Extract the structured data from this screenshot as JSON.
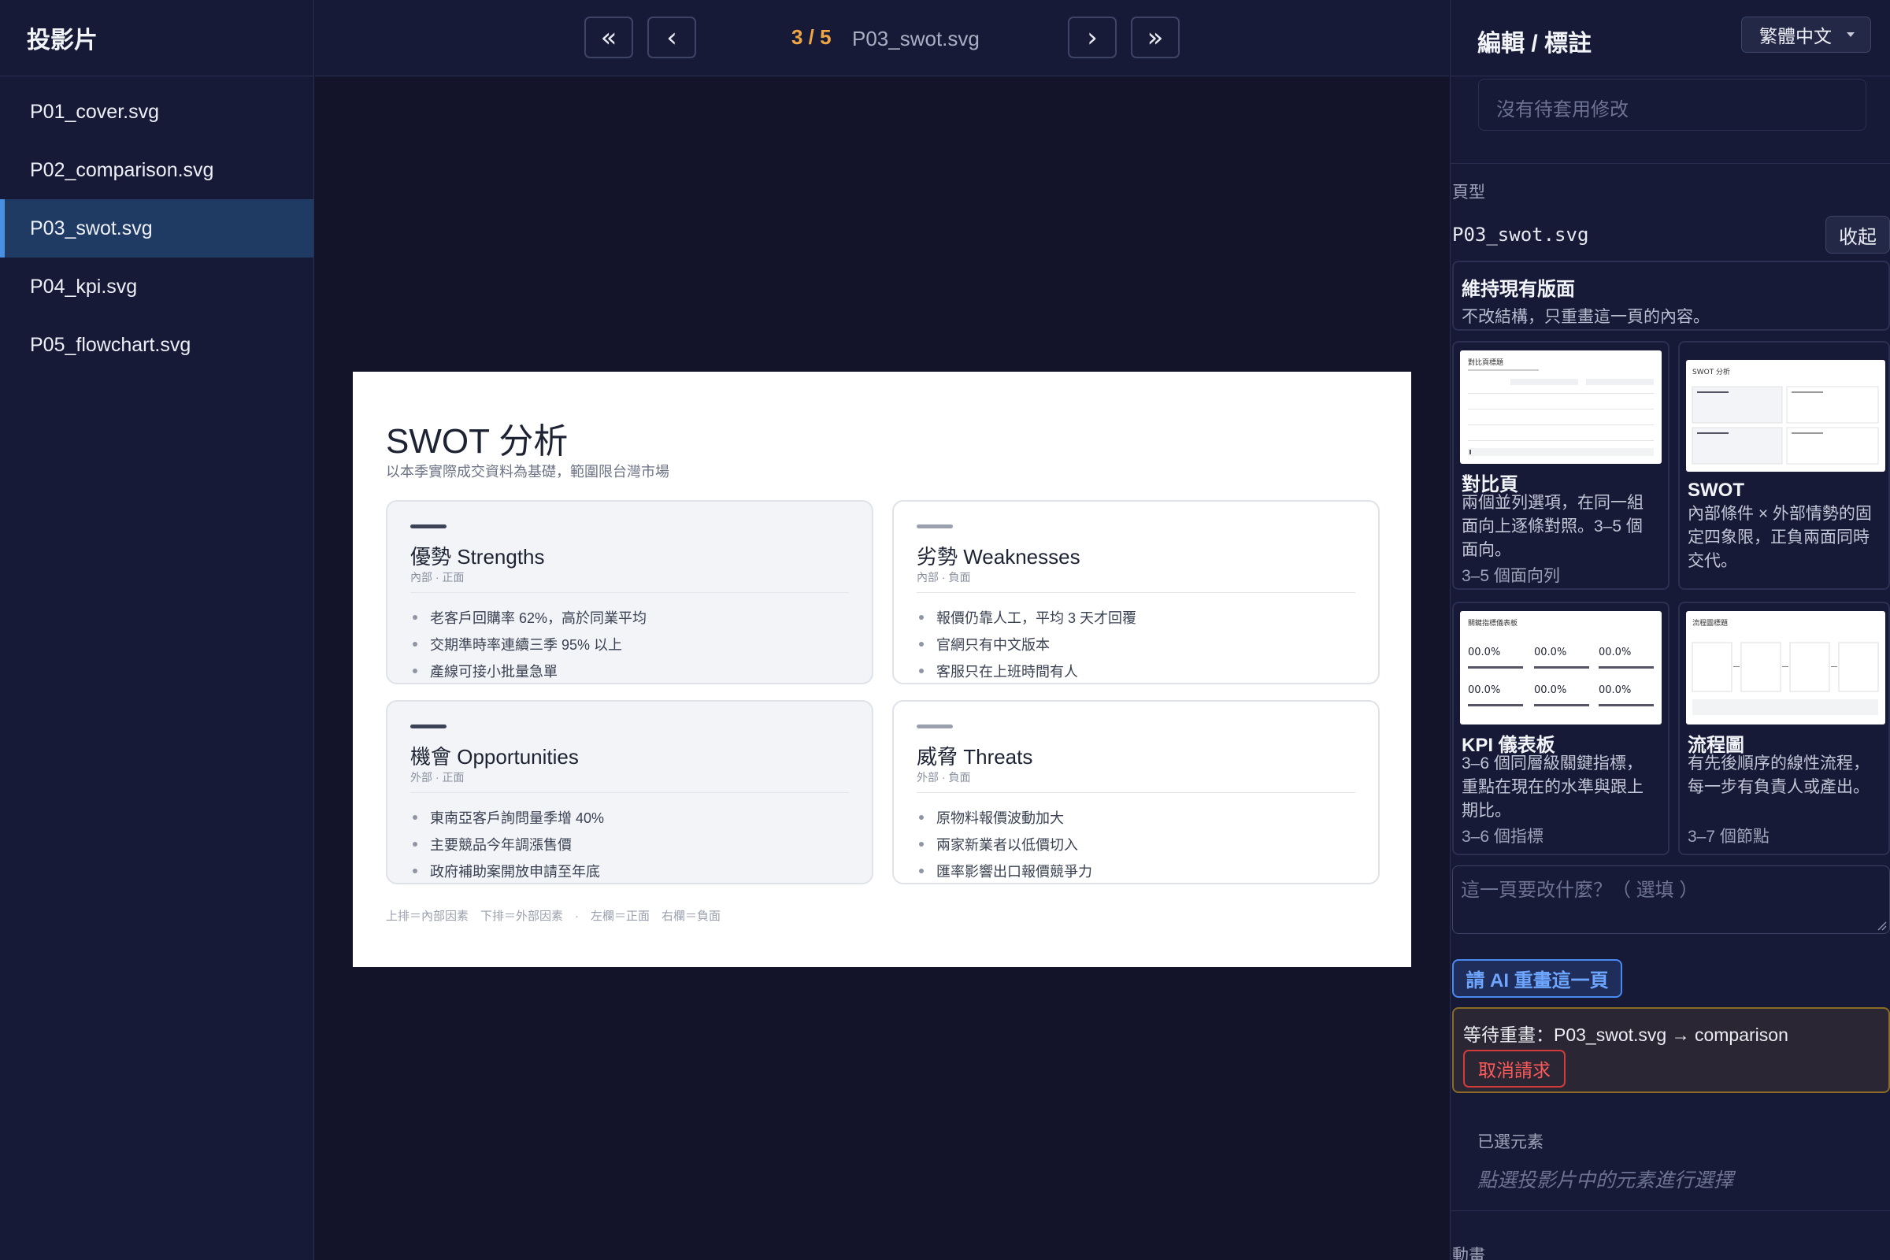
{
  "sidebar": {
    "title": "投影片",
    "slides": [
      {
        "label": "P01_cover.svg"
      },
      {
        "label": "P02_comparison.svg"
      },
      {
        "label": "P03_swot.svg"
      },
      {
        "label": "P04_kpi.svg"
      },
      {
        "label": "P05_flowchart.svg"
      }
    ],
    "active_index": 2
  },
  "toolbar": {
    "first_label": "«",
    "prev_label": "‹",
    "next_label": "›",
    "last_label": "»",
    "counter": "3 / 5",
    "filename": "P03_swot.svg"
  },
  "slide": {
    "title": "SWOT 分析",
    "subtitle": "以本季實際成交資料為基礎，範圍限台灣市場",
    "quadrants": [
      {
        "heading": "優勢 Strengths",
        "tag": "內部 · 正面",
        "items": [
          "老客戶回購率 62%，高於同業平均",
          "交期準時率連續三季 95% 以上",
          "產線可接小批量急單"
        ]
      },
      {
        "heading": "劣勢 Weaknesses",
        "tag": "內部 · 負面",
        "items": [
          "報價仍靠人工，平均 3 天才回覆",
          "官網只有中文版本",
          "客服只在上班時間有人"
        ]
      },
      {
        "heading": "機會 Opportunities",
        "tag": "外部 · 正面",
        "items": [
          "東南亞客戶詢問量季增 40%",
          "主要競品今年調漲售價",
          "政府補助案開放申請至年底"
        ]
      },
      {
        "heading": "威脅 Threats",
        "tag": "外部 · 負面",
        "items": [
          "原物料報價波動加大",
          "兩家新業者以低價切入",
          "匯率影響出口報價競爭力"
        ]
      }
    ],
    "footer": "上排＝內部因素　下排＝外部因素　·　左欄＝正面　右欄＝負面"
  },
  "panel": {
    "title": "編輯 / 標註",
    "language": "繁體中文",
    "pending_placeholder": "沒有待套用修改",
    "layout_label": "頁型",
    "layout_file": "P03_swot.svg",
    "collapse_label": "收起",
    "keep": {
      "title": "維持現有版面",
      "desc": "不改結構，只重畫這一頁的內容。"
    },
    "templates": [
      {
        "title": "對比頁",
        "desc": "兩個並列選項，在同一組面向上逐條對照。3–5 個面向。",
        "meta": "3–5 個面向列",
        "thumb_title": "對比頁標題"
      },
      {
        "title": "SWOT",
        "desc": "內部條件 × 外部情勢的固定四象限，正負兩面同時交代。",
        "meta": "",
        "thumb_title": "SWOT 分析"
      },
      {
        "title": "KPI 儀表板",
        "desc": "3–6 個同層級關鍵指標，重點在現在的水準與跟上期比。",
        "meta": "3–6 個指標",
        "thumb_title": "關鍵指標儀表板",
        "thumb_value": "00.0%"
      },
      {
        "title": "流程圖",
        "desc": "有先後順序的線性流程，每一步有負責人或產出。",
        "meta": "3–7 個節點",
        "thumb_title": "流程圖標題"
      }
    ],
    "instruction_placeholder": "這一頁要改什麼？（ 選填 ）",
    "ai_button": "請 AI 重畫這一頁",
    "waiting_text": "等待重畫：P03_swot.svg → comparison",
    "cancel_label": "取消請求",
    "selected_label": "已選元素",
    "selected_hint": "點選投影片中的元素進行選擇",
    "animation_label": "動畫"
  },
  "colors": {
    "accent": "#4a90e2",
    "counter": "#f0a645",
    "danger": "#d33a3a",
    "waiting_border": "#8a6a25",
    "quad_bar_dark": "#3c4356",
    "quad_bar_light": "#9aa0ad"
  }
}
